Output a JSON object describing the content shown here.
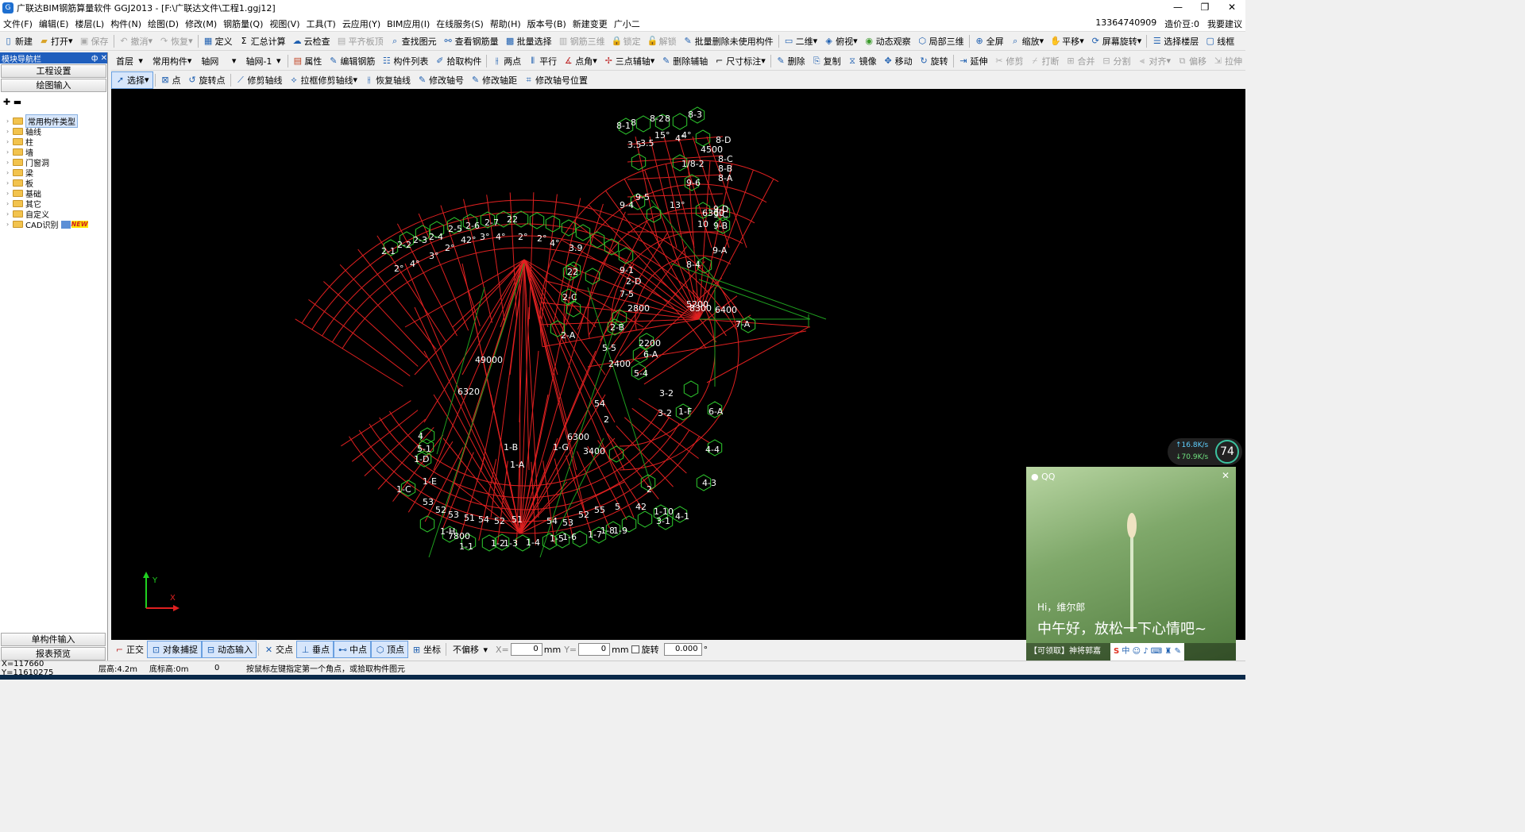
{
  "window": {
    "title": "广联达BIM钢筋算量软件 GGJ2013 - [F:\\广联达文件\\工程1.ggj12]",
    "minimize": "—",
    "restore": "❐",
    "close": "✕"
  },
  "menu": {
    "items": [
      "文件(F)",
      "编辑(E)",
      "楼层(L)",
      "构件(N)",
      "绘图(D)",
      "修改(M)",
      "钢筋量(Q)",
      "视图(V)",
      "工具(T)",
      "云应用(Y)",
      "BIM应用(I)",
      "在线服务(S)",
      "帮助(H)",
      "版本号(B)",
      "新建变更",
      "广小二"
    ],
    "phone": "13364740909",
    "bean": "造价豆:0",
    "suggest": "我要建议"
  },
  "toolbar1": [
    "新建",
    "打开",
    "保存",
    "撤消",
    "恢复",
    "定义",
    "汇总计算",
    "云检查",
    "平齐板顶",
    "查找图元",
    "查看钢筋量",
    "批量选择",
    "钢筋三维",
    "锁定",
    "解锁",
    "批量删除未使用构件",
    "二维",
    "俯视",
    "动态观察",
    "局部三维",
    "全屏",
    "缩放",
    "平移",
    "屏幕旋转",
    "选择楼层",
    "线框"
  ],
  "toolbar2": {
    "floor": "首层",
    "component_type": "常用构件",
    "axis": "轴网",
    "axis_net": "轴网-1",
    "buttons": [
      "属性",
      "编辑钢筋",
      "构件列表",
      "拾取构件",
      "两点",
      "平行",
      "点角",
      "三点辅轴",
      "删除辅轴",
      "尺寸标注",
      "删除",
      "复制",
      "镜像",
      "移动",
      "旋转",
      "延伸",
      "修剪",
      "打断",
      "合并",
      "分割",
      "对齐",
      "偏移",
      "拉伸"
    ]
  },
  "toolbar3": [
    "选择",
    "点",
    "旋转点",
    "修剪轴线",
    "拉框修剪轴线",
    "恢复轴线",
    "修改轴号",
    "修改轴距",
    "修改轴号位置"
  ],
  "sidebar": {
    "header": "模块导航栏",
    "pin": "ф",
    "close": "✕",
    "project_settings": "工程设置",
    "drawing_input": "绘图输入",
    "tree": [
      "常用构件类型",
      "轴线",
      "柱",
      "墙",
      "门窗洞",
      "梁",
      "板",
      "基础",
      "其它",
      "自定义",
      "CAD识别"
    ],
    "new_badge": "NEW",
    "single_input": "单构件输入",
    "report_preview": "报表预览"
  },
  "canvas": {
    "axis_y": "Y",
    "axis_x": "X",
    "labels": [
      "8-1",
      "8",
      "8-2",
      "8",
      "8-3",
      "3.5",
      "3.5",
      "15°",
      "4°",
      "4°",
      "4500",
      "1/8-2",
      "9-6",
      "9-5",
      "9-4",
      "13°",
      "8-D",
      "8-C",
      "8-B",
      "8-A",
      "9-D",
      "9-C",
      "9-B",
      "9-A",
      "8-4",
      "2-1",
      "2-2",
      "2-3",
      "2-4",
      "2-5",
      "2-6",
      "2-7",
      "2°",
      "4°",
      "3°",
      "2°",
      "42°",
      "3°",
      "4°",
      "2°",
      "2°",
      "4°",
      "3.9",
      "22",
      "9-1",
      "2-D",
      "2-C",
      "7-5",
      "2-B",
      "2-A",
      "5-5",
      "2200",
      "6-A",
      "5-4",
      "7-A",
      "3-2",
      "1-F",
      "3-2",
      "6-A",
      "4-4",
      "4-3",
      "4",
      "5-1",
      "1-D",
      "1-C",
      "1-B",
      "1-A",
      "1-G",
      "1-E",
      "1-H",
      "7800",
      "1-1",
      "1-2",
      "1-3",
      "1-4",
      "1-5",
      "1-6",
      "1-7",
      "1-8",
      "1-9",
      "1-10",
      "3-1",
      "4-1",
      "6320",
      "49000",
      "8300",
      "6300",
      "3400",
      "2400",
      "5200",
      "2800",
      "6400",
      "6300",
      "10",
      "2",
      "54",
      "53",
      "52",
      "53",
      "51",
      "54",
      "52",
      "54",
      "53",
      "52",
      "55",
      "5",
      "2",
      "42",
      "51",
      "22"
    ]
  },
  "statusbar1": {
    "buttons": [
      "正交",
      "对象捕捉",
      "动态输入",
      "交点",
      "垂点",
      "中点",
      "顶点",
      "坐标"
    ],
    "offset": "不偏移",
    "x_label": "X=",
    "x_value": "0",
    "y_label": "Y=",
    "y_value": "0",
    "unit": "mm",
    "rotate": "旋转",
    "rotate_value": "0.000",
    "degree": "°"
  },
  "statusbar2": {
    "coords": "X=117660 Y=11610275",
    "floor_height": "层高:4.2m",
    "base_height": "底标高:0m",
    "zero": "0",
    "hint": "按鼠标左键指定第一个角点，或拾取构件图元"
  },
  "qq": {
    "app": "QQ",
    "close": "✕",
    "greet": "Hi，维尔郎",
    "message": "中午好，放松一下心情吧~",
    "bottom": "【可领取】神将郭嘉"
  },
  "speed": {
    "up": "16.8K/s",
    "down": "70.9K/s",
    "pct": "74"
  },
  "tray": {
    "ime": "中"
  }
}
